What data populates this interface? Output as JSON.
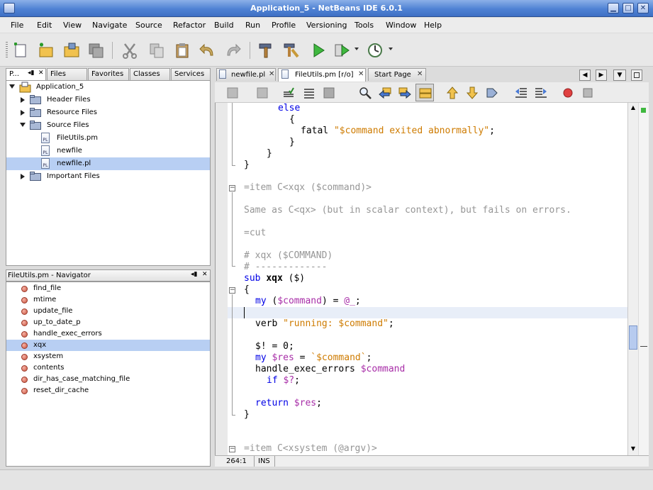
{
  "window": {
    "title": "Application_5 - NetBeans IDE 6.0.1"
  },
  "menu": [
    "File",
    "Edit",
    "View",
    "Navigate",
    "Source",
    "Refactor",
    "Build",
    "Run",
    "Profile",
    "Versioning",
    "Tools",
    "Window",
    "Help"
  ],
  "left_tabs": {
    "projects": "P...",
    "files": "Files",
    "favorites": "Favorites",
    "classes": "Classes",
    "services": "Services"
  },
  "tree": {
    "root": "Application_5",
    "header_files": "Header Files",
    "resource_files": "Resource Files",
    "source_files": "Source Files",
    "file1": "FileUtils.pm",
    "file2": "newfile",
    "file3": "newfile.pl",
    "important_files": "Important Files"
  },
  "navigator": {
    "title": "FileUtils.pm - Navigator",
    "items": [
      "find_file",
      "mtime",
      "update_file",
      "up_to_date_p",
      "handle_exec_errors",
      "xqx",
      "xsystem",
      "contents",
      "dir_has_case_matching_file",
      "reset_dir_cache"
    ],
    "selected": "xqx"
  },
  "editor_tabs": [
    "newfile.pl",
    "FileUtils.pm [r/o]",
    "Start Page"
  ],
  "code": {
    "l1": "else",
    "l2": "{",
    "l3_fn": "fatal ",
    "l3_str": "\"$command exited abnormally\"",
    "l3_end": ";",
    "l4": "}",
    "l5": "}",
    "l6": "}",
    "l7": "=item C<xqx ($command)>",
    "l8": "Same as C<qx> (but in scalar context), but fails on errors.",
    "l9": "=cut",
    "l10": "# xqx ($COMMAND)",
    "l11": "# -------------",
    "l12_kw": "sub ",
    "l12_name": "xqx",
    "l12_rest": " ($)",
    "l13": "{",
    "l14_kw": "my ",
    "l14_p": "(",
    "l14_var": "$command",
    "l14_mid": ") = ",
    "l14_var2": "@_",
    "l14_end": ";",
    "l16_fn": "verb ",
    "l16_str": "\"running: $command\"",
    "l16_end": ";",
    "l18_var": "$!",
    "l18_rest": " = 0;",
    "l19_kw": "my ",
    "l19_var": "$res",
    "l19_mid": " = ",
    "l19_str": "`$command`",
    "l19_end": ";",
    "l20_fn": "handle_exec_errors ",
    "l20_var": "$command",
    "l21_kw": "if ",
    "l21_var": "$?",
    "l21_end": ";",
    "l23_kw": "return ",
    "l23_var": "$res",
    "l23_end": ";",
    "l24": "}",
    "l26": "=item C<xsystem (@argv)>"
  },
  "status": {
    "position": "264:1",
    "mode": "INS"
  },
  "colors": {
    "keyword": "#0000e6",
    "variable": "#a82ea8",
    "string": "#ce7b00",
    "comment": "#969696",
    "selection": "#b8cff3"
  }
}
